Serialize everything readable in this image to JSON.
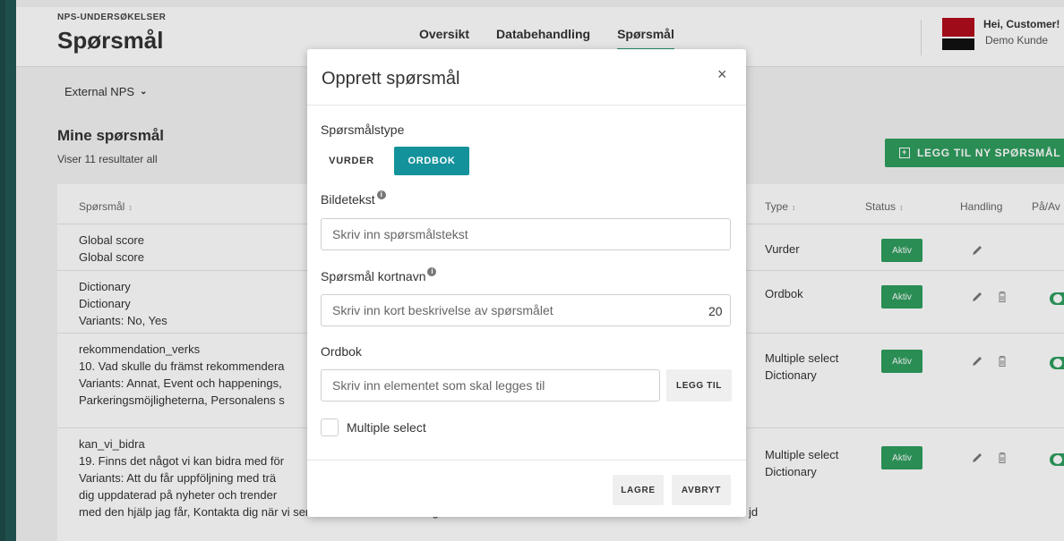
{
  "header": {
    "eyebrow": "NPS-UNDERSØKELSER",
    "title": "Spørsmål",
    "tabs": [
      {
        "label": "Oversikt"
      },
      {
        "label": "Databehandling"
      },
      {
        "label": "Spørsmål"
      }
    ],
    "active_tab": "Spørsmål",
    "user": {
      "greeting": "Hei, Customer!",
      "name": "Demo Kunde"
    }
  },
  "filter": {
    "selected": "External NPS"
  },
  "list": {
    "title": "Mine spørsmål",
    "subtitle": "Viser 11 resultater all",
    "add_button": "LEGG TIL NY SPØRSMÅL"
  },
  "table": {
    "columns": {
      "question": "Spørsmål",
      "type": "Type",
      "status": "Status",
      "action": "Handling",
      "onoff": "På/Av"
    },
    "rows": [
      {
        "lines": [
          "Global score",
          "Global score"
        ],
        "type": [
          "Vurder"
        ],
        "status": "Aktiv"
      },
      {
        "lines": [
          "Dictionary",
          "Dictionary",
          "Variants: No, Yes"
        ],
        "type": [
          "Ordbok"
        ],
        "status": "Aktiv"
      },
      {
        "lines": [
          "rekommendation_verks",
          "10. Vad skulle du främst rekommendera",
          "Variants: Annat, Event och happenings,",
          "Parkeringsmöjligheterna, Personalens s"
        ],
        "type": [
          "Multiple select",
          "Dictionary"
        ],
        "status": "Aktiv"
      },
      {
        "lines": [
          "kan_vi_bidra",
          "19. Finns det något vi kan bidra med för",
          "Variants: Att du får uppföljning med trä",
          "dig uppdaterad på nyheter och trender",
          "med den hjälp jag får, Kontakta dig när vi ser att du uteblir från träningen"
        ],
        "extra": "jd",
        "type": [
          "Multiple select",
          "Dictionary"
        ],
        "status": "Aktiv"
      }
    ]
  },
  "modal": {
    "title": "Opprett spørsmål",
    "close_label": "×",
    "type_label": "Spørsmålstype",
    "type_options": [
      "VURDER",
      "ORDBOK"
    ],
    "type_selected": "ORDBOK",
    "caption_label": "Bildetekst",
    "caption_placeholder": "Skriv inn spørsmålstekst",
    "shortname_label": "Spørsmål kortnavn",
    "shortname_placeholder": "Skriv inn kort beskrivelse av spørsmålet",
    "shortname_counter": "20",
    "dictionary_label": "Ordbok",
    "dictionary_placeholder": "Skriv inn elementet som skal legges til",
    "add_label": "LEGG TIL",
    "multiple_select_label": "Multiple select",
    "multiple_select_checked": false,
    "save_label": "LAGRE",
    "cancel_label": "AVBRYT"
  },
  "colors": {
    "accent_green": "#2e9e5e",
    "accent_teal": "#14929b",
    "brand_red": "#b30d1d"
  }
}
